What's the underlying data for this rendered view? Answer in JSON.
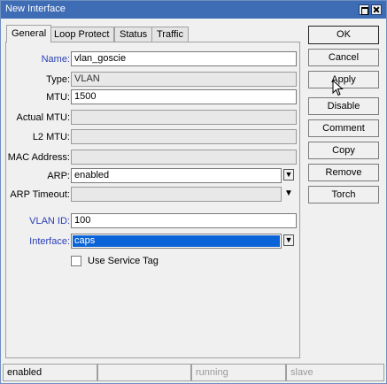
{
  "window": {
    "title": "New Interface"
  },
  "tabs": [
    "General",
    "Loop Protect",
    "Status",
    "Traffic"
  ],
  "form": {
    "name": {
      "label": "Name:",
      "value": "vlan_goscie"
    },
    "type": {
      "label": "Type:",
      "value": "VLAN"
    },
    "mtu": {
      "label": "MTU:",
      "value": "1500"
    },
    "actual_mtu": {
      "label": "Actual MTU:",
      "value": ""
    },
    "l2_mtu": {
      "label": "L2 MTU:",
      "value": ""
    },
    "mac_address": {
      "label": "MAC Address:",
      "value": ""
    },
    "arp": {
      "label": "ARP:",
      "value": "enabled"
    },
    "arp_timeout": {
      "label": "ARP Timeout:",
      "value": ""
    },
    "vlan_id": {
      "label": "VLAN ID:",
      "value": "100"
    },
    "interface": {
      "label": "Interface:",
      "value": "caps"
    },
    "use_service_tag": {
      "label": "Use Service Tag",
      "checked": false
    }
  },
  "buttons": {
    "ok": "OK",
    "cancel": "Cancel",
    "apply": "Apply",
    "disable": "Disable",
    "comment": "Comment",
    "copy": "Copy",
    "remove": "Remove",
    "torch": "Torch"
  },
  "status": [
    "enabled",
    "",
    "running",
    "slave"
  ],
  "colors": {
    "titlebar": "#3e6cb5",
    "accent_label": "#2a3fb6",
    "selection": "#0a64d8"
  }
}
